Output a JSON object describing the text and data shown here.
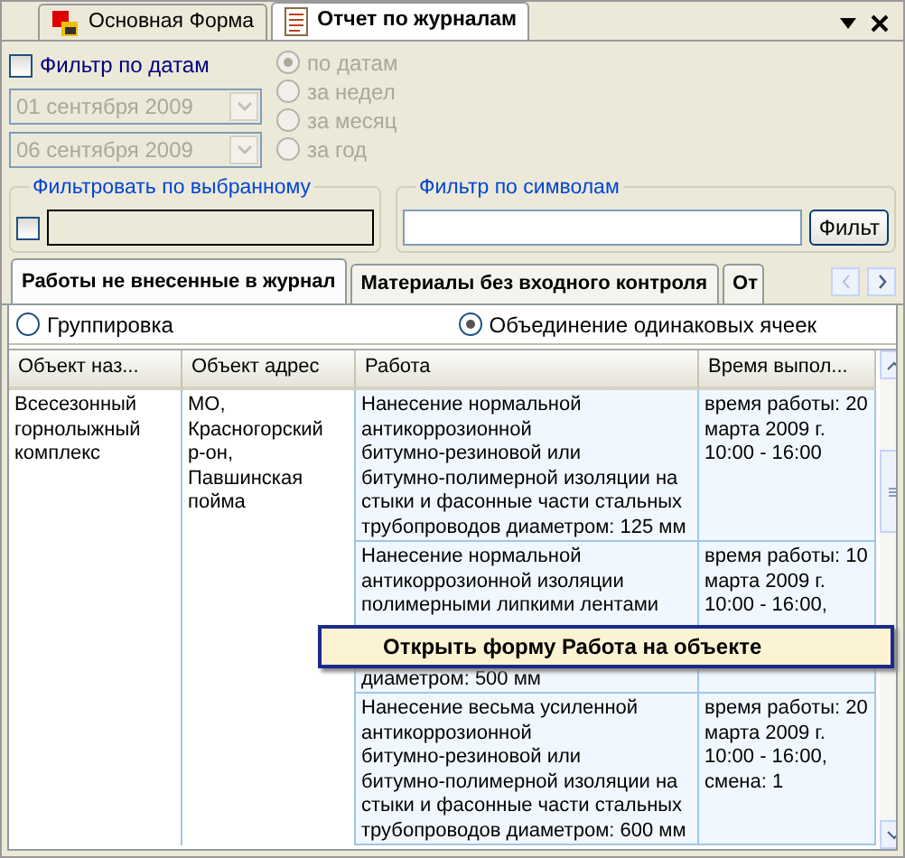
{
  "doc_tabs": [
    {
      "label": "Основная Форма",
      "selected": false
    },
    {
      "label": "Отчет по журналам",
      "selected": true
    }
  ],
  "date_filter": {
    "label": "Фильтр по датам",
    "checked": false,
    "disabled": true,
    "dates": [
      "01 сентября 2009",
      "06 сентября 2009"
    ],
    "periods": [
      {
        "label": "по датам",
        "selected": true
      },
      {
        "label": "за недел",
        "selected": false
      },
      {
        "label": "за месяц",
        "selected": false
      },
      {
        "label": "за год",
        "selected": false
      }
    ]
  },
  "select_filter": {
    "title": "Фильтровать по выбранному",
    "checked": false
  },
  "symbol_filter": {
    "title": "Фильтр по символам",
    "button": "Фильт"
  },
  "report_tabs": [
    {
      "label": "Работы не внесенные в журнал",
      "selected": true
    },
    {
      "label": "Материалы без входного контроля",
      "selected": false
    },
    {
      "label": "От",
      "selected": false
    }
  ],
  "view_options": [
    {
      "label": "Группировка",
      "selected": false
    },
    {
      "label": "Объединение одинаковых ячеек",
      "selected": true
    }
  ],
  "table": {
    "columns": [
      "Объект наз...",
      "Объект адрес",
      "Работа",
      "Время выпол..."
    ],
    "groups": [
      {
        "object": "Всесезонный\nгорнолыжный\nкомплекс",
        "address": "МО,\nКрасногорский\nр-он,\nПавшинская\nпойма",
        "works": [
          {
            "work": [
              "Нанесение нормальной\nантикоррозионной\nбитумно-резиновой или\nбитумно-полимерной изоляции на\nстыки и фасонные части стальных\nтрубопроводов диаметром: 125 мм"
            ],
            "time": "время работы: 20\nмарта 2009 г.\n10:00 - 16:00"
          },
          {
            "work": [
              "Нанесение нормальной\nантикоррозионной изоляции\nполимерными липкими лентами",
              "диаметром: 500 мм"
            ],
            "time": "время работы: 10\nмарта 2009 г.\n10:00 - 16:00,"
          },
          {
            "work": [
              "Нанесение весьма усиленной\nантикоррозионной\nбитумно-резиновой или\nбитумно-полимерной изоляции на\nстыки и фасонные части стальных\nтрубопроводов диаметром: 600 мм"
            ],
            "time": "время работы: 20\nмарта 2009 г.\n10:00 - 16:00,\nсмена: 1"
          }
        ]
      }
    ]
  },
  "context_menu": {
    "items": [
      "Открыть форму Работа на объекте"
    ]
  }
}
